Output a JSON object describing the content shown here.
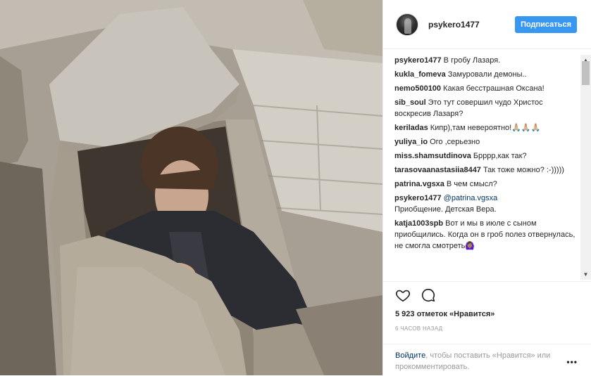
{
  "post": {
    "username": "psykero1477",
    "follow_label": "Подписаться",
    "likes_text": "5 923 отметок «Нравится»",
    "time_text": "6 часов назад",
    "login_link": "Войдите",
    "login_text": ", чтобы поставить «Нравится» или прокомментировать.",
    "more_label": "•••"
  },
  "comments": [
    {
      "user": "psykero1477",
      "text": "В гробу Лазаря."
    },
    {
      "user": "kukla_fomeva",
      "text": "Замуровали демоны.."
    },
    {
      "user": "nemo500100",
      "text": "Какая бесстрашная Оксана!"
    },
    {
      "user": "sib_soul",
      "text": "Это тут совершил чудо Христос воскресив Лазаря?"
    },
    {
      "user": "keriladas",
      "text": "Кипр),там невероятно!🙏🏼🙏🏼🙏🏼"
    },
    {
      "user": "yuliya_io",
      "text": "Ого ,серьезно"
    },
    {
      "user": "miss.shamsutdinova",
      "text": "Брррр,как так?"
    },
    {
      "user": "tarasovaanastasiia8447",
      "text": "Так тоже можно? :-)))))"
    },
    {
      "user": "patrina.vgsxa",
      "text": "В чем смысл?"
    },
    {
      "user": "psykero1477",
      "mention": "@patrina.vgsxa",
      "text": "Приобщение. Детская Вера."
    },
    {
      "user": "katja1003spb",
      "text": "Вот и мы в июле с сыном приобщились. Когда он в гроб полез отвернулась, не смогла смотреть🙆🏽‍♀️"
    }
  ],
  "icons": {
    "like": "heart-outline-icon",
    "comment": "speech-bubble-icon",
    "more": "ellipsis-icon"
  },
  "colors": {
    "accent": "#3897f0",
    "link": "#003569",
    "muted": "#999999"
  }
}
